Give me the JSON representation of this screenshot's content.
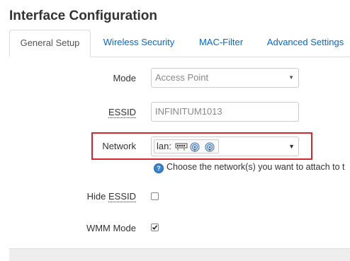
{
  "page": {
    "title": "Interface Configuration"
  },
  "tabs": [
    {
      "label": "General Setup",
      "active": true
    },
    {
      "label": "Wireless Security",
      "active": false
    },
    {
      "label": "MAC-Filter",
      "active": false
    },
    {
      "label": "Advanced Settings",
      "active": false
    }
  ],
  "form": {
    "mode": {
      "label": "Mode",
      "value": "Access Point"
    },
    "essid": {
      "label": "ESSID",
      "value": "INFINITUM1013"
    },
    "network": {
      "label": "Network",
      "value": "lan:",
      "icons": [
        "ethernet-switch-icon",
        "wifi-icon",
        "wifi-icon"
      ],
      "help": "Choose the network(s) you want to attach to t"
    },
    "hide_essid": {
      "label_prefix": "Hide ",
      "label_abbr": "ESSID",
      "checked": false
    },
    "wmm_mode": {
      "label": "WMM Mode",
      "checked": true
    }
  },
  "colors": {
    "link": "#0069d6",
    "highlight": "#d9262c",
    "help_icon": "#3a83d0"
  }
}
